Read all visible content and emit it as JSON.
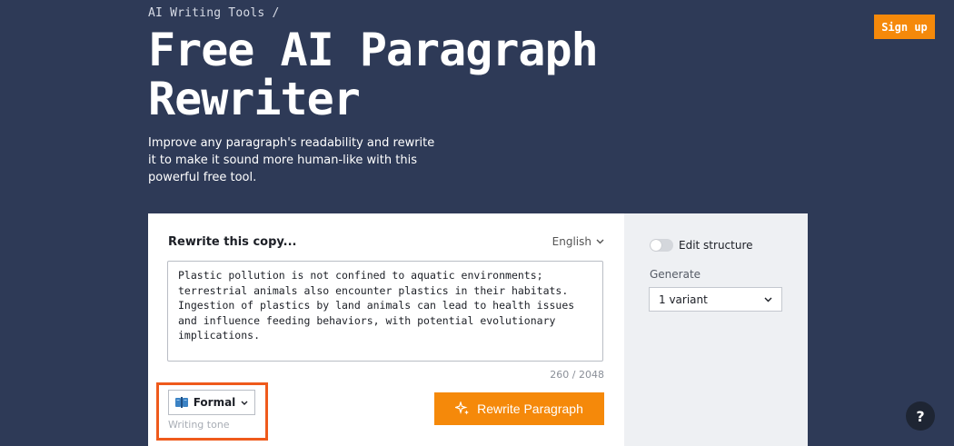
{
  "breadcrumb": "AI Writing Tools /",
  "header": {
    "signup_label": "Sign up"
  },
  "hero": {
    "title": "Free AI Paragraph Rewriter",
    "subtitle": "Improve any paragraph's readability and rewrite it to make it sound more human-like with this powerful free tool."
  },
  "editor": {
    "label": "Rewrite this copy...",
    "language": "English",
    "text": "Plastic pollution is not confined to aquatic environments; terrestrial animals also encounter plastics in their habitats. Ingestion of plastics by land animals can lead to health issues and influence feeding behaviors, with potential evolutionary implications.",
    "counter": "260 / 2048"
  },
  "tone": {
    "value": "Formal",
    "caption": "Writing tone"
  },
  "action": {
    "rewrite_label": "Rewrite Paragraph"
  },
  "sidebar": {
    "edit_structure_label": "Edit structure",
    "generate_label": "Generate",
    "generate_value": "1 variant"
  },
  "help": {
    "label": "?"
  },
  "colors": {
    "background": "#2e3a57",
    "accent": "#f5890a",
    "highlight": "#ef5a1c"
  }
}
